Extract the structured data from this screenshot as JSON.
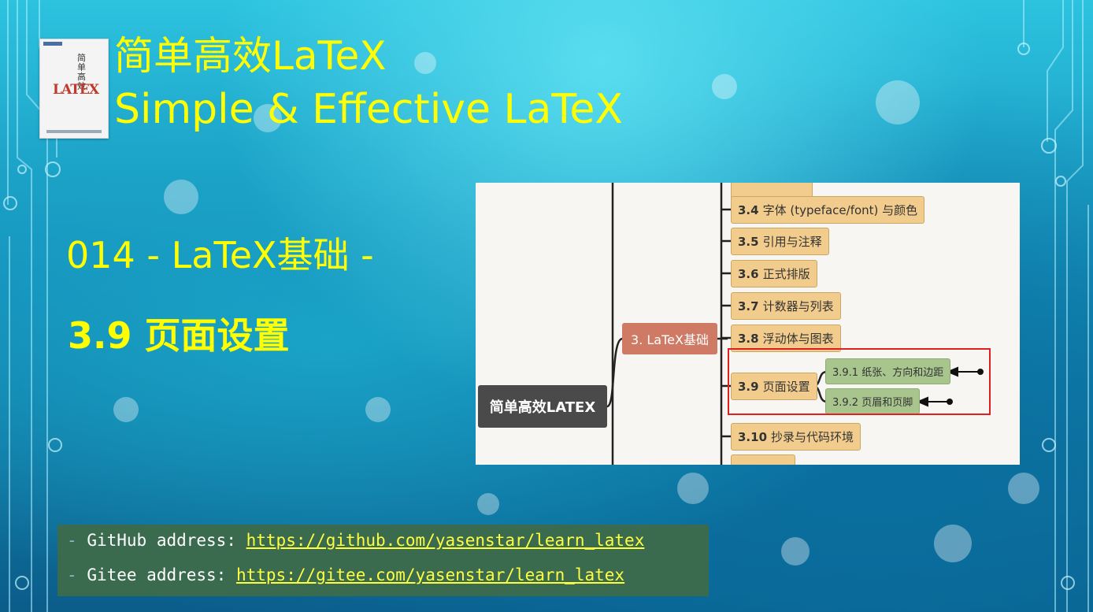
{
  "title": {
    "cn": "简单高效LaTeX",
    "en": "Simple & Effective LaTeX"
  },
  "book_cover": {
    "cn_title": "简单高效",
    "latex_logo": "LATEX"
  },
  "lesson": {
    "line1": "014 - LaTeX基础 -",
    "line2": "3.9 页面设置"
  },
  "mindmap": {
    "root": "简单高效LATEX",
    "chapter": "3. LaTeX基础",
    "nodes": [
      {
        "num": "3.4",
        "label": "字体 (typeface/font) 与颜色"
      },
      {
        "num": "3.5",
        "label": "引用与注释"
      },
      {
        "num": "3.6",
        "label": "正式排版"
      },
      {
        "num": "3.7",
        "label": "计数器与列表"
      },
      {
        "num": "3.8",
        "label": "浮动体与图表"
      },
      {
        "num": "3.9",
        "label": "页面设置"
      },
      {
        "num": "3.10",
        "label": "抄录与代码环境"
      }
    ],
    "subnodes": [
      {
        "label": "3.9.1 纸张、方向和边距"
      },
      {
        "label": "3.9.2 页眉和页脚"
      }
    ],
    "highlight_color": "#e02020"
  },
  "links": {
    "github_label": "GitHub address:",
    "github_url": "https://github.com/yasenstar/learn_latex",
    "gitee_label": "Gitee address:",
    "gitee_url": "https://gitee.com/yasenstar/learn_latex",
    "dash": "-"
  },
  "colors": {
    "title": "#ffff00",
    "link_panel": "#3b6b4e",
    "root_node": "#4a4a4a",
    "chapter_node": "#cf7a64",
    "section_node": "#f2cc8c",
    "sub_node": "#a8c58d"
  }
}
